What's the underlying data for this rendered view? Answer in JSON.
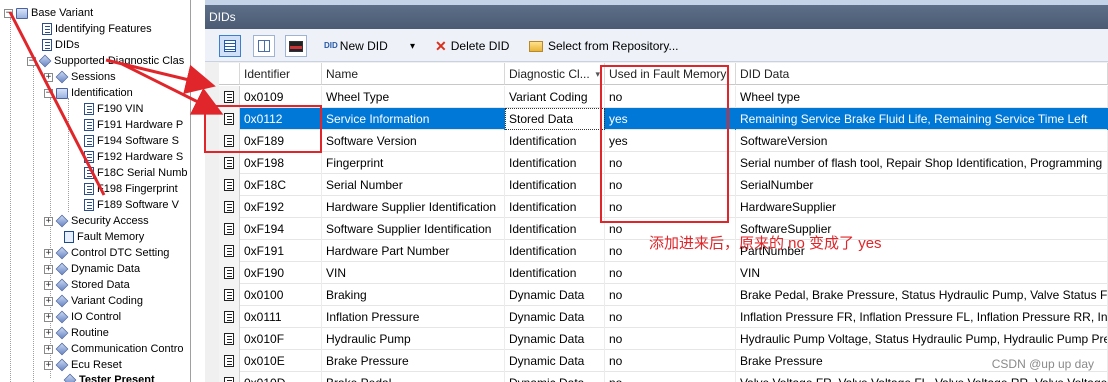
{
  "tree": {
    "items": [
      {
        "label": "Base Variant"
      },
      {
        "label": "Identifying Features"
      },
      {
        "label": "DIDs"
      },
      {
        "label": "Supported Diagnostic Clas"
      },
      {
        "label": "Sessions"
      },
      {
        "label": "Identification"
      },
      {
        "label": "F190 VIN"
      },
      {
        "label": "F191 Hardware P"
      },
      {
        "label": "F194 Software S"
      },
      {
        "label": "F192 Hardware S"
      },
      {
        "label": "F18C Serial Numb"
      },
      {
        "label": "F198 Fingerprint"
      },
      {
        "label": "F189 Software V"
      },
      {
        "label": "Security Access"
      },
      {
        "label": "Fault Memory"
      },
      {
        "label": "Control DTC Setting"
      },
      {
        "label": "Dynamic Data"
      },
      {
        "label": "Stored Data"
      },
      {
        "label": "Variant Coding"
      },
      {
        "label": "IO Control"
      },
      {
        "label": "Routine"
      },
      {
        "label": "Communication Contro"
      },
      {
        "label": "Ecu Reset"
      },
      {
        "label": "Tester Present"
      }
    ]
  },
  "panel": {
    "title": "DIDs"
  },
  "toolbar": {
    "new_did": "New DID",
    "delete_did": "Delete DID",
    "select_repo": "Select from Repository...",
    "new_badge": "DID",
    "dropdown": "▾"
  },
  "grid": {
    "columns": [
      "Identifier",
      "Name",
      "Diagnostic Cl...",
      "Used in Fault Memory",
      "DID Data"
    ],
    "rows": [
      {
        "id": "0x0109",
        "name": "Wheel Type",
        "cls": "Variant Coding",
        "fm": "no",
        "data": "Wheel type"
      },
      {
        "id": "0x0112",
        "name": "Service Information",
        "cls": "Stored Data",
        "fm": "yes",
        "data": "Remaining Service Brake Fluid Life, Remaining Service Time Left"
      },
      {
        "id": "0xF189",
        "name": "Software Version",
        "cls": "Identification",
        "fm": "yes",
        "data": "SoftwareVersion"
      },
      {
        "id": "0xF198",
        "name": "Fingerprint",
        "cls": "Identification",
        "fm": "no",
        "data": "Serial number of flash tool, Repair Shop Identification, Programming"
      },
      {
        "id": "0xF18C",
        "name": "Serial Number",
        "cls": "Identification",
        "fm": "no",
        "data": "SerialNumber"
      },
      {
        "id": "0xF192",
        "name": "Hardware Supplier Identification",
        "cls": "Identification",
        "fm": "no",
        "data": "HardwareSupplier"
      },
      {
        "id": "0xF194",
        "name": "Software Supplier Identification",
        "cls": "Identification",
        "fm": "no",
        "data": "SoftwareSupplier"
      },
      {
        "id": "0xF191",
        "name": "Hardware Part Number",
        "cls": "Identification",
        "fm": "no",
        "data": "PartNumber"
      },
      {
        "id": "0xF190",
        "name": "VIN",
        "cls": "Identification",
        "fm": "no",
        "data": "VIN"
      },
      {
        "id": "0x0100",
        "name": "Braking",
        "cls": "Dynamic Data",
        "fm": "no",
        "data": "Brake Pedal, Brake Pressure, Status Hydraulic Pump, Valve Status F"
      },
      {
        "id": "0x0111",
        "name": "Inflation Pressure",
        "cls": "Dynamic Data",
        "fm": "no",
        "data": "Inflation Pressure FR, Inflation Pressure FL, Inflation Pressure RR, In"
      },
      {
        "id": "0x010F",
        "name": "Hydraulic Pump",
        "cls": "Dynamic Data",
        "fm": "no",
        "data": "Hydraulic Pump Voltage, Status Hydraulic Pump, Hydraulic Pump Pre"
      },
      {
        "id": "0x010E",
        "name": "Brake Pressure",
        "cls": "Dynamic Data",
        "fm": "no",
        "data": "Brake Pressure"
      },
      {
        "id": "0x010D",
        "name": "Brake Pedal",
        "cls": "Dynamic Data",
        "fm": "no",
        "data": "Valve Voltage FR, Valve Voltage FL, Valve Voltage RR, Valve Voltage"
      }
    ]
  },
  "annotation": {
    "note": "添加进来后，原来的 no 变成了 yes",
    "color": "#e0262a"
  },
  "watermark": "CSDN @up up day",
  "colors": {
    "selection": "#0078d7",
    "titlebar": "#4f5f78"
  }
}
